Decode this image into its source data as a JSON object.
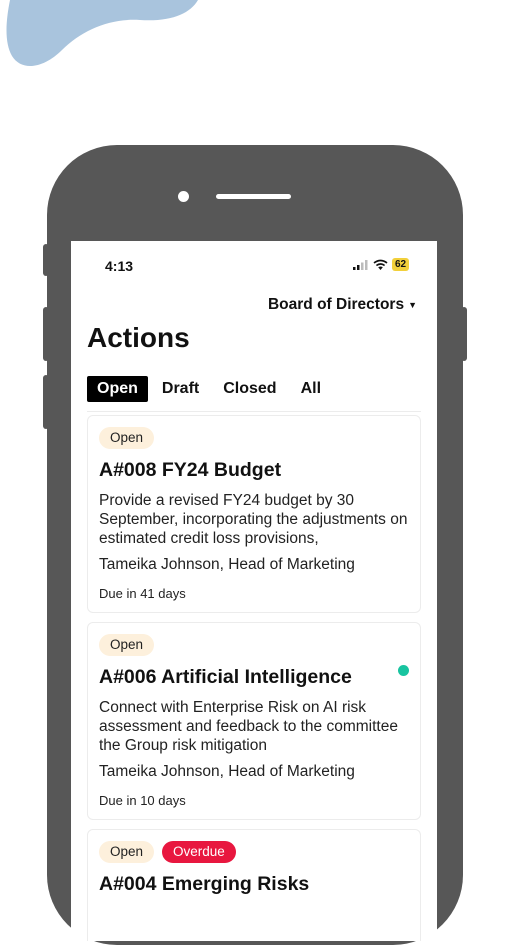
{
  "colors": {
    "blob": "#a9c4dd",
    "phone_frame": "#575757",
    "tab_active_bg": "#000000",
    "badge_open_bg": "#fdf0dc",
    "badge_overdue_bg": "#e8173f",
    "unread_dot": "#18c4a0",
    "battery": "#f2d03b"
  },
  "status_bar": {
    "time": "4:13",
    "battery": "62",
    "icons": [
      "signal-icon",
      "wifi-icon",
      "battery-icon"
    ]
  },
  "org_selector": {
    "label": "Board of Directors"
  },
  "page_title": "Actions",
  "tabs": [
    {
      "label": "Open",
      "active": true
    },
    {
      "label": "Draft",
      "active": false
    },
    {
      "label": "Closed",
      "active": false
    },
    {
      "label": "All",
      "active": false
    }
  ],
  "actions": [
    {
      "status": "Open",
      "title": "A#008 FY24 Budget",
      "description": "Provide a revised FY24 budget by 30 September, incorporating the adjustments on estimated credit loss provisions,",
      "owner": "Tameika Johnson, Head of Marketing",
      "due": "Due in 41 days",
      "unread": false
    },
    {
      "status": "Open",
      "title": "A#006 Artificial Intelligence",
      "description": "Connect with Enterprise Risk on AI risk assessment and feedback to the committee the Group risk mitigation",
      "owner": "Tameika Johnson, Head of Marketing",
      "due": "Due in 10 days",
      "unread": true
    },
    {
      "status": "Open",
      "overdue": "Overdue",
      "title": "A#004 Emerging Risks",
      "unread": false
    }
  ]
}
